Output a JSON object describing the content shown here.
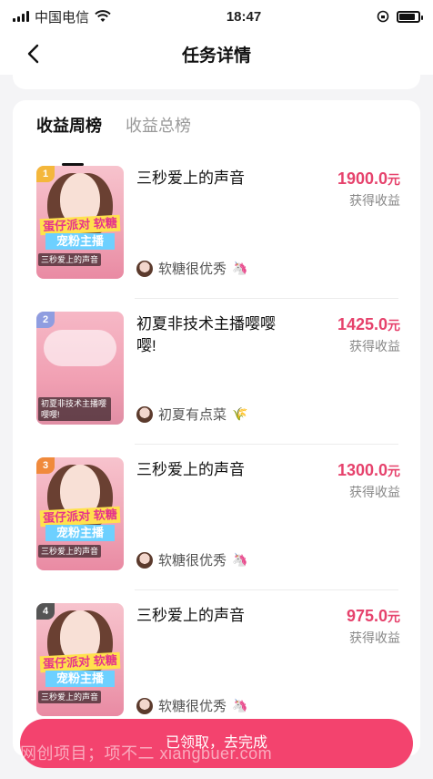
{
  "status_bar": {
    "carrier": "中国电信",
    "time": "18:47",
    "battery_level": 0.85
  },
  "navbar": {
    "title": "任务详情"
  },
  "tabs": [
    {
      "label": "收益周榜",
      "active": true
    },
    {
      "label": "收益总榜",
      "active": false
    }
  ],
  "rank_list": [
    {
      "rank": "1",
      "title": "三秒爱上的声音",
      "amount": "1900.0",
      "unit": "元",
      "earn_label": "获得收益",
      "user": "软糖很优秀",
      "user_emoji": "🦄",
      "thumb_caption": "三秒爱上的声音",
      "thumb_banner1": "蛋仔派对 软糖",
      "thumb_banner2": "宠粉主播"
    },
    {
      "rank": "2",
      "title": "初夏非技术主播嘤嘤嘤!",
      "amount": "1425.0",
      "unit": "元",
      "earn_label": "获得收益",
      "user": "初夏有点菜",
      "user_emoji": "🌾",
      "thumb_caption": "初夏非技术主播嘤嘤嘤!"
    },
    {
      "rank": "3",
      "title": "三秒爱上的声音",
      "amount": "1300.0",
      "unit": "元",
      "earn_label": "获得收益",
      "user": "软糖很优秀",
      "user_emoji": "🦄",
      "thumb_caption": "三秒爱上的声音",
      "thumb_banner1": "蛋仔派对 软糖",
      "thumb_banner2": "宠粉主播"
    },
    {
      "rank": "4",
      "title": "三秒爱上的声音",
      "amount": "975.0",
      "unit": "元",
      "earn_label": "获得收益",
      "user": "软糖很优秀",
      "user_emoji": "🦄",
      "thumb_caption": "三秒爱上的声音",
      "thumb_banner1": "蛋仔派对 软糖",
      "thumb_banner2": "宠粉主播"
    }
  ],
  "cta": {
    "label": "已领取，去完成"
  },
  "watermark": "网创项目；项不二 xiangbuer.com",
  "colors": {
    "accent": "#f3436e",
    "amount": "#e6426c"
  },
  "icons": {
    "back": "chevron-left-icon",
    "wifi": "wifi-icon",
    "signal": "signal-icon",
    "battery": "battery-icon",
    "lock": "rotation-lock-icon"
  }
}
